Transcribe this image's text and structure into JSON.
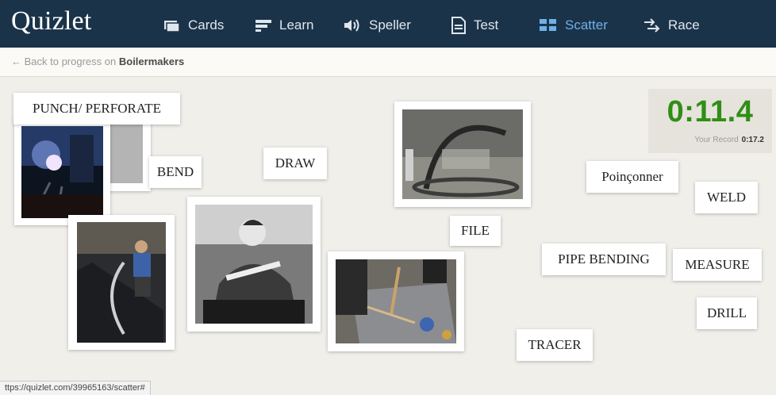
{
  "header": {
    "logo": "Quizlet",
    "nav": [
      {
        "label": "Cards",
        "icon": "cards-icon"
      },
      {
        "label": "Learn",
        "icon": "learn-icon"
      },
      {
        "label": "Speller",
        "icon": "speaker-icon"
      },
      {
        "label": "Test",
        "icon": "test-document-icon"
      },
      {
        "label": "Scatter",
        "icon": "scatter-icon",
        "active": true
      },
      {
        "label": "Race",
        "icon": "race-icon"
      }
    ],
    "active_color": "#6fb0e8",
    "bar_color": "#1b3349"
  },
  "back_link": {
    "prefix": "← Back to progress on",
    "set_name": "Boilermakers"
  },
  "words": {
    "punch": "PUNCH/ PERFORATE",
    "bend": "BEND",
    "draw": "DRAW",
    "file": "FILE",
    "poinconner": "Poinçonner",
    "weld": "WELD",
    "pipe_bending": "PIPE BENDING",
    "measure": "MEASURE",
    "drill": "DRILL",
    "tracer": "TRACER"
  },
  "photos": [
    {
      "icon": "welding-photo"
    },
    {
      "icon": "blank-card"
    },
    {
      "icon": "pipe-bending-photo"
    },
    {
      "icon": "drawing-tool-photo"
    },
    {
      "icon": "workshop-arch-photo"
    },
    {
      "icon": "sheet-metal-tracing-photo"
    }
  ],
  "timer": {
    "value": "0:11.4",
    "record_label": "Your Record",
    "record_value": "0:17.2",
    "color": "#2f8f15"
  },
  "status_url": "ttps://quizlet.com/39965163/scatter#"
}
